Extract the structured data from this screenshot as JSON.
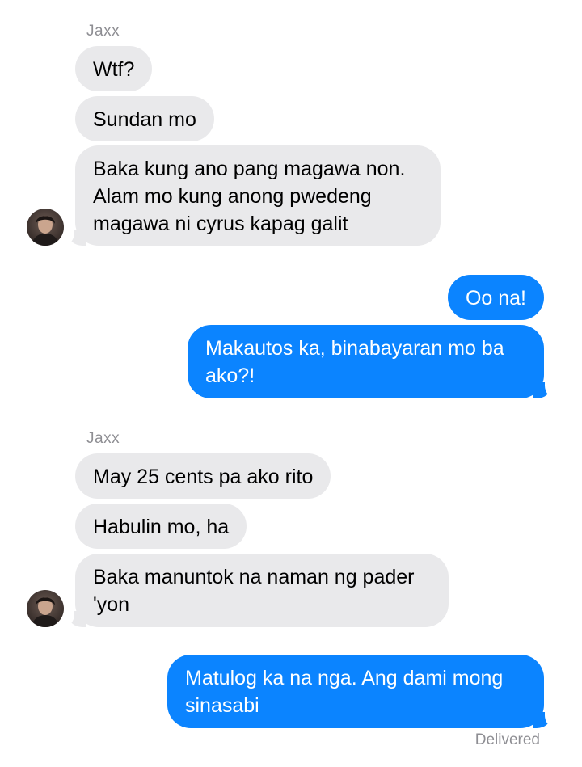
{
  "thread": {
    "groups": [
      {
        "sender": "Jaxx",
        "messages": [
          "Wtf?",
          "Sundan mo",
          "Baka kung ano pang magawa non.\nAlam mo kung anong pwedeng\nmagawa ni cyrus kapag galit"
        ]
      },
      {
        "sender": "me",
        "messages": [
          "Oo na!",
          "Makautos ka, binabayaran mo ba\nako?!"
        ]
      },
      {
        "sender": "Jaxx",
        "messages": [
          "May 25 cents pa ako rito",
          "Habulin mo, ha",
          "Baka manuntok na naman ng pader\n'yon"
        ]
      },
      {
        "sender": "me",
        "messages": [
          "Matulog ka na nga. Ang dami mong\nsinasabi"
        ]
      }
    ],
    "delivery_status": "Delivered"
  },
  "colors": {
    "incoming_bubble": "#e9e9eb",
    "outgoing_bubble": "#0b84ff",
    "meta_text": "#8e8e93"
  },
  "icons": {
    "avatar": "contact-photo-avatar"
  }
}
